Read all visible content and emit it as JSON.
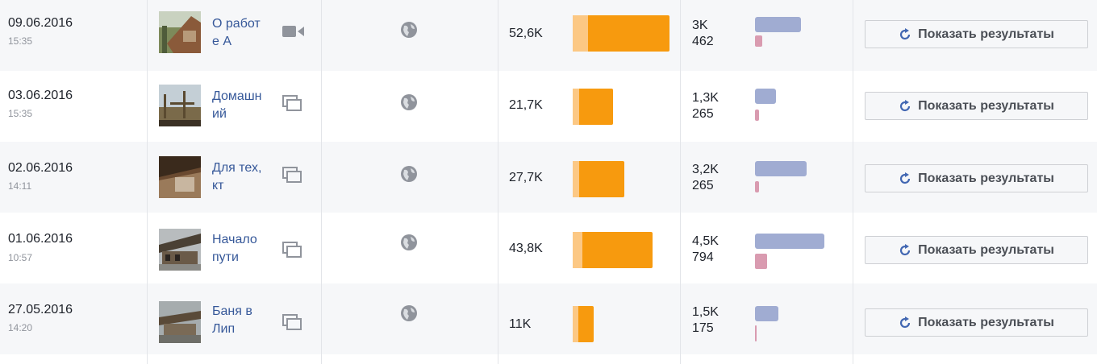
{
  "rows": [
    {
      "date": "09.06.2016",
      "time": "15:35",
      "title": "О работе А",
      "type_icon": "video-icon",
      "reach": "52,6K",
      "reach_bar": {
        "organic": 0.16,
        "paid": 0.84
      },
      "eng_top": "3K",
      "eng_bottom": "462",
      "button": "Показать результаты"
    },
    {
      "date": "03.06.2016",
      "time": "15:35",
      "title": "Домашний",
      "type_icon": "carousel-icon",
      "reach": "21,7K",
      "reach_bar": {
        "organic": 0.16,
        "paid": 0.84
      },
      "eng_top": "1,3K",
      "eng_bottom": "265",
      "button": "Показать результаты"
    },
    {
      "date": "02.06.2016",
      "time": "14:11",
      "title": "Для тех, кт",
      "type_icon": "carousel-icon",
      "reach": "27,7K",
      "reach_bar": {
        "organic": 0.13,
        "paid": 0.87
      },
      "eng_top": "3,2K",
      "eng_bottom": "265",
      "button": "Показать результаты"
    },
    {
      "date": "01.06.2016",
      "time": "10:57",
      "title": "Начало пути",
      "type_icon": "carousel-icon",
      "reach": "43,8K",
      "reach_bar": {
        "organic": 0.12,
        "paid": 0.88
      },
      "eng_top": "4,5K",
      "eng_bottom": "794",
      "button": "Показать результаты"
    },
    {
      "date": "27.05.2016",
      "time": "14:20",
      "title": "Баня в Лип",
      "type_icon": "carousel-icon",
      "reach": "11K",
      "reach_bar": {
        "organic": 0.25,
        "paid": 0.75
      },
      "eng_top": "1,5K",
      "eng_bottom": "175",
      "button": "Показать результаты"
    }
  ],
  "colors": {
    "organic": "#fcc884",
    "paid": "#f79a0e",
    "engagement_primary": "#a0acd2",
    "engagement_secondary": "#d99bb0",
    "link": "#365899"
  }
}
